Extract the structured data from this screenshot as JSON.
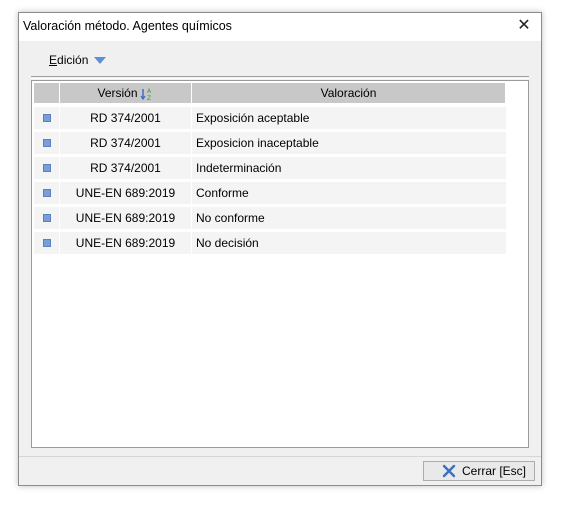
{
  "window": {
    "title": "Valoración método. Agentes químicos",
    "close_glyph": "✕"
  },
  "menu": {
    "edicion_first": "E",
    "edicion_rest": "dición"
  },
  "grid": {
    "headers": {
      "version": "Versión",
      "valoracion": "Valoración"
    },
    "sort_icon_text": "A Z",
    "rows": [
      {
        "version": "RD 374/2001",
        "valoracion": "Exposición aceptable"
      },
      {
        "version": "RD 374/2001",
        "valoracion": "Exposicion inaceptable"
      },
      {
        "version": "RD 374/2001",
        "valoracion": "Indeterminación"
      },
      {
        "version": "UNE-EN 689:2019",
        "valoracion": "Conforme"
      },
      {
        "version": "UNE-EN 689:2019",
        "valoracion": "No conforme"
      },
      {
        "version": "UNE-EN 689:2019",
        "valoracion": "No decisión"
      }
    ]
  },
  "footer": {
    "close_button": "Cerrar [Esc]"
  },
  "colors": {
    "accent": "#5d8fd6",
    "header_bg": "#c8c8c8",
    "row_bg": "#f4f4f4",
    "marker": "#7b9ed6",
    "close_icon": "#3a6fc4"
  }
}
